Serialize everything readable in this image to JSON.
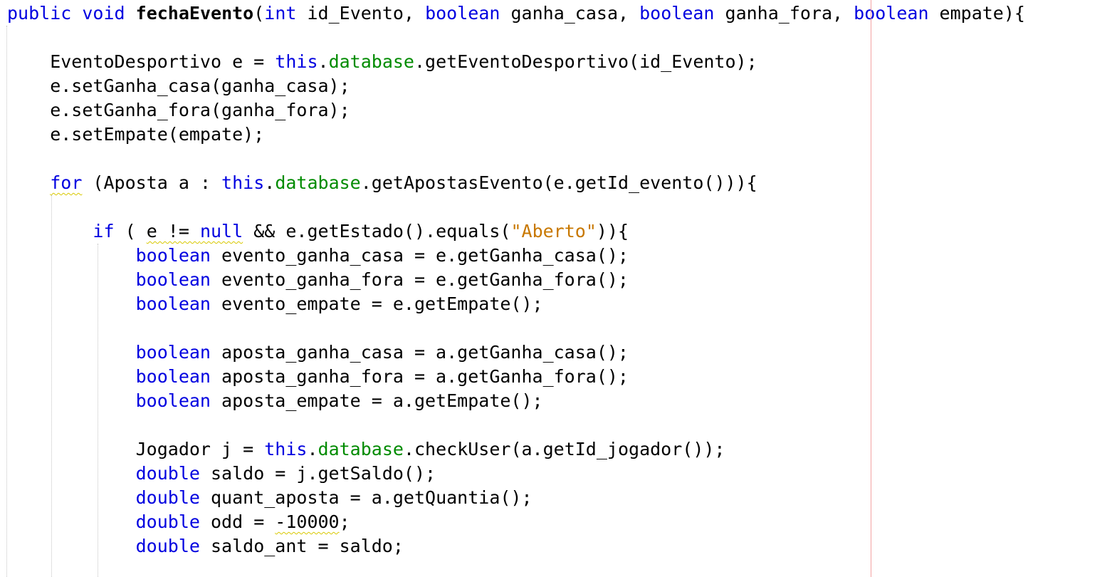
{
  "editor": {
    "lines": [
      {
        "tokens": [
          {
            "t": "public",
            "c": "kw"
          },
          {
            "t": " "
          },
          {
            "t": "void",
            "c": "kw"
          },
          {
            "t": " "
          },
          {
            "t": "fechaEvento",
            "c": "bold"
          },
          {
            "t": "("
          },
          {
            "t": "int",
            "c": "kw"
          },
          {
            "t": " id_Evento, "
          },
          {
            "t": "boolean",
            "c": "kw"
          },
          {
            "t": " ganha_casa, "
          },
          {
            "t": "boolean",
            "c": "kw"
          },
          {
            "t": " ganha_fora, "
          },
          {
            "t": "boolean",
            "c": "kw"
          },
          {
            "t": " empate){"
          }
        ]
      },
      {
        "tokens": []
      },
      {
        "tokens": [
          {
            "t": "    EventoDesportivo e = "
          },
          {
            "t": "this",
            "c": "kw"
          },
          {
            "t": "."
          },
          {
            "t": "database",
            "c": "fld"
          },
          {
            "t": ".getEventoDesportivo(id_Evento);"
          }
        ]
      },
      {
        "tokens": [
          {
            "t": "    e.setGanha_casa(ganha_casa);"
          }
        ]
      },
      {
        "tokens": [
          {
            "t": "    e.setGanha_fora(ganha_fora);"
          }
        ]
      },
      {
        "tokens": [
          {
            "t": "    e.setEmpate(empate);"
          }
        ]
      },
      {
        "tokens": []
      },
      {
        "tokens": [
          {
            "t": "    "
          },
          {
            "t": "for",
            "c": "kw squiggle"
          },
          {
            "t": " (Aposta a : "
          },
          {
            "t": "this",
            "c": "kw"
          },
          {
            "t": "."
          },
          {
            "t": "database",
            "c": "fld"
          },
          {
            "t": ".getApostasEvento(e.getId_evento())){"
          }
        ]
      },
      {
        "tokens": []
      },
      {
        "tokens": [
          {
            "t": "        "
          },
          {
            "t": "if",
            "c": "kw"
          },
          {
            "t": " ( "
          },
          {
            "t": "e != ",
            "c": "squiggle"
          },
          {
            "t": "null",
            "c": "kw squiggle"
          },
          {
            "t": " && e.getEstado().equals("
          },
          {
            "t": "\"Aberto\"",
            "c": "str"
          },
          {
            "t": ")){"
          }
        ]
      },
      {
        "tokens": [
          {
            "t": "            "
          },
          {
            "t": "boolean",
            "c": "kw"
          },
          {
            "t": " evento_ganha_casa = e.getGanha_casa();"
          }
        ]
      },
      {
        "tokens": [
          {
            "t": "            "
          },
          {
            "t": "boolean",
            "c": "kw"
          },
          {
            "t": " evento_ganha_fora = e.getGanha_fora();"
          }
        ]
      },
      {
        "tokens": [
          {
            "t": "            "
          },
          {
            "t": "boolean",
            "c": "kw"
          },
          {
            "t": " evento_empate = e.getEmpate();"
          }
        ]
      },
      {
        "tokens": []
      },
      {
        "tokens": [
          {
            "t": "            "
          },
          {
            "t": "boolean",
            "c": "kw"
          },
          {
            "t": " aposta_ganha_casa = a.getGanha_casa();"
          }
        ]
      },
      {
        "tokens": [
          {
            "t": "            "
          },
          {
            "t": "boolean",
            "c": "kw"
          },
          {
            "t": " aposta_ganha_fora = a.getGanha_fora();"
          }
        ]
      },
      {
        "tokens": [
          {
            "t": "            "
          },
          {
            "t": "boolean",
            "c": "kw"
          },
          {
            "t": " aposta_empate = a.getEmpate();"
          }
        ]
      },
      {
        "tokens": []
      },
      {
        "tokens": [
          {
            "t": "            Jogador j = "
          },
          {
            "t": "this",
            "c": "kw"
          },
          {
            "t": "."
          },
          {
            "t": "database",
            "c": "fld"
          },
          {
            "t": ".checkUser(a.getId_jogador());"
          }
        ]
      },
      {
        "tokens": [
          {
            "t": "            "
          },
          {
            "t": "double",
            "c": "kw"
          },
          {
            "t": " saldo = j.getSaldo();"
          }
        ]
      },
      {
        "tokens": [
          {
            "t": "            "
          },
          {
            "t": "double",
            "c": "kw"
          },
          {
            "t": " quant_aposta = a.getQuantia();"
          }
        ]
      },
      {
        "tokens": [
          {
            "t": "            "
          },
          {
            "t": "double",
            "c": "kw"
          },
          {
            "t": " odd = "
          },
          {
            "t": "-10000",
            "c": "squiggle"
          },
          {
            "t": ";"
          }
        ]
      },
      {
        "tokens": [
          {
            "t": "            "
          },
          {
            "t": "double",
            "c": "kw"
          },
          {
            "t": " saldo_ant = saldo;"
          }
        ]
      }
    ]
  },
  "colors": {
    "keyword": "#0000e0",
    "field": "#008b00",
    "string": "#c87800",
    "warning_squiggle": "#d8c800",
    "margin_line": "#f3a3a3",
    "indent_guide": "#c4c4c4"
  }
}
